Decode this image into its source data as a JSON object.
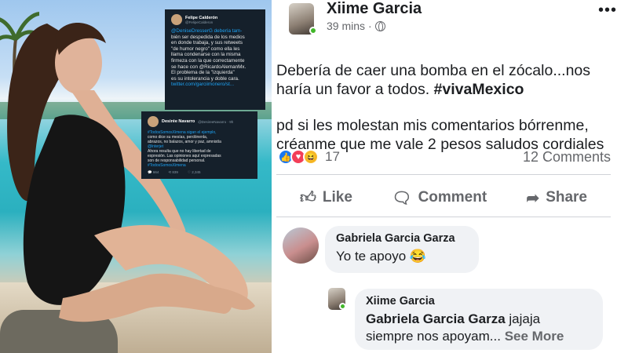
{
  "left_photo": {
    "tweet1": {
      "name": "Felipe Calderón",
      "handle": "@FelipeCalderon",
      "line1": "@DeniseDresserG debería tam-",
      "line2": "bién ser despedida de los medios",
      "line3": "en donde trabaja, y sus retweets",
      "line4": "\"de humor negro\" como ella les",
      "line5": "llama condenarse con la misma",
      "line6": "firmeza con la que correctamente",
      "line7": "se hace con @RicardoAlemanMx.",
      "line8": "El problema de la \"izquierda\"",
      "line9": "es su intolerancia y doble cara.",
      "line10": "twitter.com/garciimonero/st..."
    },
    "tweet2": {
      "name": "Desirée Navarro",
      "handle": "@DesireeNavarro · 9h",
      "line1": "#TodosSomosXimena sigan el ejemplo,",
      "line2": "como dice su mesías, perdónenla,",
      "line3": "abrazos, no balazos, amor y paz, amnistía",
      "line4": "@lnterjet",
      "line5": "Ahora resulta que no hay libertad de",
      "line6": "expresión. Las opiniones aquí expresadas",
      "line7": "son de responsabilidad personal.",
      "line8": "#TodosSomosXimena",
      "stat_replies": "664",
      "stat_retweets": "839",
      "stat_likes": "2,345"
    }
  },
  "post": {
    "author": "Xiime Garcia",
    "time": "39 mins",
    "separator": "·",
    "more_label": "•••",
    "text_line1": "Debería de caer una bomba en el zócalo...nos",
    "text_line2_prefix": "haría un favor a todos. ",
    "hashtag": "#vivaMexico",
    "text_line3": "pd si les molestan mis comentarios bórrenme,",
    "text_line4": "créanme que me vale 2 pesos  saludos cordiales",
    "reaction_count": "17",
    "comment_count": "12 Comments",
    "actions": {
      "like": "Like",
      "comment": "Comment",
      "share": "Share"
    }
  },
  "comments": [
    {
      "author": "Gabriela Garcia Garza",
      "text": "Yo te apoyo 😂"
    },
    {
      "author": "Xiime Garcia",
      "mention": "Gabriela Garcia Garza",
      "text": " jajaja",
      "text2": "siempre nos apoyam...",
      "see_more": " See More"
    }
  ],
  "colors": {
    "facebook_blue": "#1877f2",
    "online_green": "#42b72a",
    "twitter_dark": "#15202b",
    "twitter_link": "#1da1f2"
  }
}
